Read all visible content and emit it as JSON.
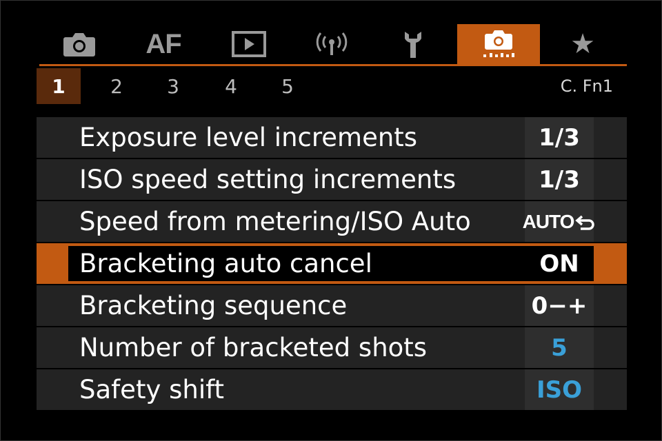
{
  "tabs": [
    {
      "name": "shooting",
      "icon": "camera-icon",
      "label": ""
    },
    {
      "name": "af",
      "icon": "af-icon",
      "label": "AF"
    },
    {
      "name": "playback",
      "icon": "play-icon",
      "label": ""
    },
    {
      "name": "wireless",
      "icon": "wireless-icon",
      "label": ""
    },
    {
      "name": "setup",
      "icon": "wrench-icon",
      "label": ""
    },
    {
      "name": "custom-functions",
      "icon": "custom-camera-icon",
      "label": "",
      "active": true
    },
    {
      "name": "my-menu",
      "icon": "star-icon",
      "label": "★"
    }
  ],
  "subtabs": [
    "1",
    "2",
    "3",
    "4",
    "5"
  ],
  "active_subtab": "1",
  "page_label": "C. Fn1",
  "menu": {
    "items": [
      {
        "label": "Exposure level increments",
        "value": "1/3"
      },
      {
        "label": "ISO speed setting increments",
        "value": "1/3"
      },
      {
        "label": "Speed from metering/ISO Auto",
        "value": "AUTO"
      },
      {
        "label": "Bracketing auto cancel",
        "value": "ON"
      },
      {
        "label": "Bracketing sequence",
        "value": "0−+"
      },
      {
        "label": "Number of bracketed shots",
        "value": "5"
      },
      {
        "label": "Safety shift",
        "value": "ISO"
      }
    ],
    "selected_index": 3
  },
  "colors": {
    "accent": "#c25a12",
    "value_highlight": "#3aa0d8"
  }
}
